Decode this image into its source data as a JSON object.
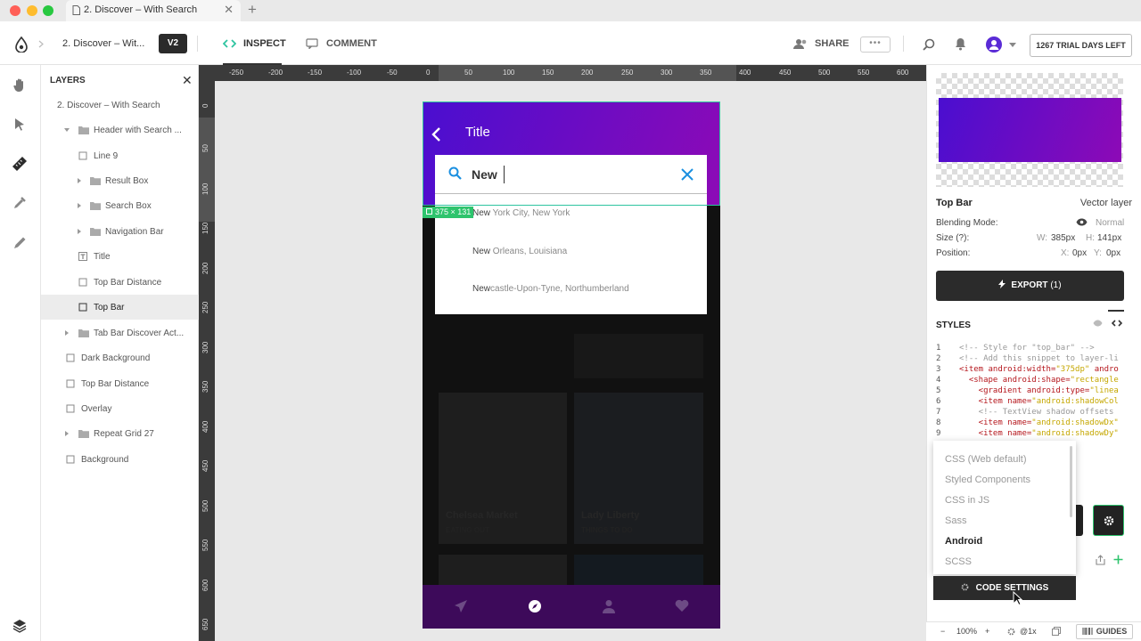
{
  "browser": {
    "tab_title": "2. Discover – With Search",
    "tab_close": "✕",
    "new_tab": "+",
    "colors": {
      "close": "#ff5f57",
      "minimize": "#febc2e",
      "zoom": "#28c840"
    }
  },
  "toolbar": {
    "doc_name": "2. Discover – Wit...",
    "version": "V2",
    "inspect_label": "INSPECT",
    "comment_label": "COMMENT",
    "share_label": "SHARE",
    "more_label": "•••",
    "trial_label": "1267 TRIAL DAYS LEFT"
  },
  "left_rail": {
    "icons": [
      "hand-icon",
      "pointer-icon",
      "ruler-icon",
      "eyedropper-icon",
      "pen-icon",
      "layers-icon"
    ]
  },
  "layers": {
    "title": "LAYERS",
    "close": "✕",
    "items": [
      {
        "label": "2. Discover – With Search"
      },
      {
        "label": "Header with Search ..."
      },
      {
        "label": "Line 9"
      },
      {
        "label": "Result Box"
      },
      {
        "label": "Search Box"
      },
      {
        "label": "Navigation Bar"
      },
      {
        "label": "Title"
      },
      {
        "label": "Top Bar Distance"
      },
      {
        "label": "Top Bar"
      },
      {
        "label": "Tab Bar Discover Act..."
      },
      {
        "label": "Dark Background"
      },
      {
        "label": "Top Bar Distance"
      },
      {
        "label": "Overlay"
      },
      {
        "label": "Repeat Grid 27"
      },
      {
        "label": "Background"
      }
    ]
  },
  "ruler": {
    "top": [
      "-250",
      "-200",
      "-150",
      "-100",
      "-50",
      "0",
      "50",
      "100",
      "150",
      "200",
      "250",
      "300",
      "350",
      "400",
      "450",
      "500",
      "550",
      "600"
    ],
    "left": [
      "0",
      "50",
      "100",
      "150",
      "200",
      "250",
      "300",
      "350",
      "400",
      "450",
      "500",
      "550",
      "600",
      "650"
    ]
  },
  "phone": {
    "title": "Title",
    "search_value": "New",
    "results": [
      {
        "match": "New",
        "rest": " York City, New York"
      },
      {
        "match": "New",
        "rest": " Orleans, Louisiana"
      },
      {
        "match": "New",
        "rest": "castle-Upon-Tyne, Northumberland"
      }
    ],
    "cards": [
      {
        "title": "Chelsea Market",
        "subtitle": "EATING OUT"
      },
      {
        "title": "Lady Liberty",
        "subtitle": "THINGS TO DO"
      }
    ],
    "selection_badge": "375 × 131",
    "colors": {
      "gradient_start": "#4a0ed0",
      "gradient_end": "#8d0ab6",
      "search_accent": "#1a8fe0",
      "tab_bar": "#3d0a5a"
    }
  },
  "inspector": {
    "layer_name": "Top Bar",
    "layer_kind": "Vector layer",
    "blending_label": "Blending Mode:",
    "blending_value": "Normal",
    "size_label": "Size (?):",
    "w_label": "W:",
    "w_value": "385px",
    "h_label": "H:",
    "h_value": "141px",
    "position_label": "Position:",
    "x_label": "X:",
    "x_value": "0px",
    "y_label": "Y:",
    "y_value": "0px",
    "export_label": "EXPORT",
    "export_count": "(1)",
    "styles_title": "STYLES"
  },
  "code": {
    "lines": [
      {
        "n": "1",
        "parts": [
          {
            "t": "<!-- Style for \"top_bar\" -->",
            "c": "cm"
          }
        ]
      },
      {
        "n": "2",
        "parts": [
          {
            "t": "<!-- Add this snippet to layer-li",
            "c": "cm"
          }
        ]
      },
      {
        "n": "3",
        "parts": [
          {
            "t": "<item android:width=",
            "c": "tag"
          },
          {
            "t": "\"375dp\"",
            "c": "str"
          },
          {
            "t": " andro",
            "c": "tag"
          }
        ]
      },
      {
        "n": "4",
        "parts": [
          {
            "t": "  <shape android:shape=",
            "c": "tag"
          },
          {
            "t": "\"rectangle",
            "c": "str"
          }
        ]
      },
      {
        "n": "5",
        "parts": [
          {
            "t": "    <gradient android:type=",
            "c": "tag"
          },
          {
            "t": "\"linea",
            "c": "str"
          }
        ]
      },
      {
        "n": "6",
        "parts": [
          {
            "t": "    <item name=",
            "c": "tag"
          },
          {
            "t": "\"android:shadowCol",
            "c": "str"
          }
        ]
      },
      {
        "n": "7",
        "parts": [
          {
            "t": "    <!-- TextView shadow offsets",
            "c": "cm"
          }
        ]
      },
      {
        "n": "8",
        "parts": [
          {
            "t": "    <item name=",
            "c": "tag"
          },
          {
            "t": "\"android:shadowDx\"",
            "c": "str"
          }
        ]
      },
      {
        "n": "9",
        "parts": [
          {
            "t": "    <item name=",
            "c": "tag"
          },
          {
            "t": "\"android:shadowDy\"",
            "c": "str"
          }
        ]
      }
    ]
  },
  "language_menu": {
    "options": [
      "CSS (Web default)",
      "Styled Components",
      "CSS in JS",
      "Sass",
      "Android",
      "SCSS"
    ],
    "selected": "Android",
    "settings_label": "CODE SETTINGS"
  },
  "statusbar": {
    "zoom_out": "−",
    "zoom_value": "100%",
    "zoom_in": "+",
    "density": "@1x",
    "guides_label": "GUIDES"
  }
}
